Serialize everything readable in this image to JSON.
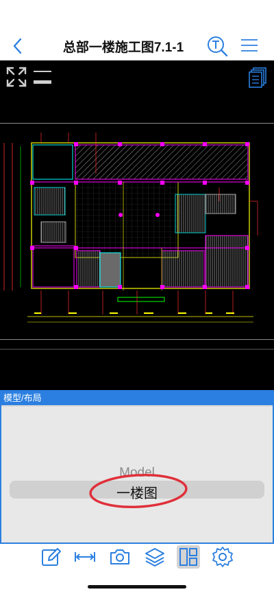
{
  "header": {
    "title": "总部一楼施工图7.1-1",
    "back_icon": "chevron-left-icon",
    "search_icon": "text-search-icon",
    "menu_icon": "hamburger-menu-icon"
  },
  "canvas": {
    "fullscreen_icon": "expand-arrows-icon",
    "lines_icon": "line-weight-icon",
    "layers_icon": "document-stack-icon"
  },
  "layout_panel": {
    "title": "模型/布局",
    "items": [
      "Model",
      "一楼图"
    ],
    "selected": "一楼图"
  },
  "toolbar": {
    "items": [
      {
        "name": "annotate-icon"
      },
      {
        "name": "measure-icon"
      },
      {
        "name": "camera-icon"
      },
      {
        "name": "layers-icon"
      },
      {
        "name": "layout-icon",
        "active": true
      },
      {
        "name": "settings-icon"
      }
    ]
  },
  "colors": {
    "accent": "#2b7fe0",
    "canvas_bg": "#000000",
    "cad_magenta": "#ff00ff",
    "cad_yellow": "#ffff00",
    "cad_cyan": "#00ffff",
    "annotation_red": "#e0303a"
  }
}
